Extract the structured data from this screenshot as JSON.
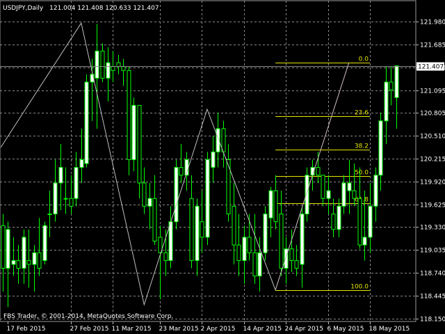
{
  "header": {
    "symbol": "USDJPY,Daily",
    "ohlc": "121.004 121.408 120.633 121.407"
  },
  "copyright": "FBS Trader, © 2001-2014, MetaQuotes Software Corp.",
  "current_price": "121.407",
  "colors": {
    "background": "#000000",
    "grid": "#8a8a8a",
    "candle": "#00ff00",
    "bull_body": "#ffffff",
    "bear_body": "#000000",
    "zigzag": "#c0c0c0",
    "fib_levels": "#e6e600",
    "fib_trend": "#ff0000",
    "axis_text": "#ffffff",
    "price_line": "#8c8c8c"
  },
  "chart_data": {
    "type": "candlestick",
    "ylim": [
      118.15,
      122.05
    ],
    "y_ticks": [
      "121.980",
      "121.685",
      "121.390",
      "121.095",
      "120.805",
      "120.510",
      "120.215",
      "119.920",
      "119.625",
      "119.330",
      "119.035",
      "118.740",
      "118.445",
      "118.150"
    ],
    "x_ticks": [
      "17 Feb 2015",
      "27 Feb 2015",
      "11 Mar 2015",
      "23 Mar 2015",
      "2 Apr 2015",
      "14 Apr 2015",
      "24 Apr 2015",
      "6 May 2015",
      "18 May 2015"
    ],
    "x_tick_index": [
      1,
      13,
      21,
      30,
      38,
      46,
      54,
      62,
      70
    ],
    "grid": true,
    "candles": [
      {
        "o": 119.35,
        "h": 119.5,
        "l": 118.5,
        "c": 118.8
      },
      {
        "o": 118.8,
        "h": 119.4,
        "l": 118.3,
        "c": 119.3
      },
      {
        "o": 118.85,
        "h": 119.2,
        "l": 118.7,
        "c": 118.9
      },
      {
        "o": 118.9,
        "h": 119.1,
        "l": 118.6,
        "c": 118.8
      },
      {
        "o": 118.8,
        "h": 119.3,
        "l": 118.6,
        "c": 119.2
      },
      {
        "o": 118.9,
        "h": 119.3,
        "l": 118.55,
        "c": 118.85
      },
      {
        "o": 118.85,
        "h": 119.1,
        "l": 118.5,
        "c": 119.0
      },
      {
        "o": 119.0,
        "h": 119.45,
        "l": 118.7,
        "c": 118.8
      },
      {
        "o": 118.9,
        "h": 119.4,
        "l": 118.85,
        "c": 119.35
      },
      {
        "o": 119.5,
        "h": 119.8,
        "l": 119.2,
        "c": 119.5
      },
      {
        "o": 119.5,
        "h": 120.2,
        "l": 119.4,
        "c": 119.9
      },
      {
        "o": 119.9,
        "h": 120.4,
        "l": 119.55,
        "c": 120.1
      },
      {
        "o": 119.7,
        "h": 120.1,
        "l": 119.5,
        "c": 119.7
      },
      {
        "o": 119.7,
        "h": 120.0,
        "l": 119.5,
        "c": 119.6
      },
      {
        "o": 119.7,
        "h": 120.3,
        "l": 119.6,
        "c": 120.1
      },
      {
        "o": 120.1,
        "h": 120.6,
        "l": 119.9,
        "c": 120.2
      },
      {
        "o": 120.15,
        "h": 121.3,
        "l": 120.1,
        "c": 121.2
      },
      {
        "o": 121.2,
        "h": 121.5,
        "l": 120.7,
        "c": 121.3
      },
      {
        "o": 121.25,
        "h": 121.95,
        "l": 120.6,
        "c": 121.6
      },
      {
        "o": 121.6,
        "h": 121.7,
        "l": 121.2,
        "c": 121.25
      },
      {
        "o": 121.25,
        "h": 121.65,
        "l": 120.95,
        "c": 121.45
      },
      {
        "o": 121.4,
        "h": 121.6,
        "l": 121.2,
        "c": 121.35
      },
      {
        "o": 121.45,
        "h": 121.55,
        "l": 121.3,
        "c": 121.4
      },
      {
        "o": 121.4,
        "h": 121.5,
        "l": 121.15,
        "c": 121.35
      },
      {
        "o": 121.35,
        "h": 121.4,
        "l": 120.0,
        "c": 120.2
      },
      {
        "o": 120.2,
        "h": 121.0,
        "l": 120.05,
        "c": 120.9
      },
      {
        "o": 120.9,
        "h": 120.9,
        "l": 119.7,
        "c": 119.9
      },
      {
        "o": 119.9,
        "h": 120.1,
        "l": 119.5,
        "c": 119.6
      },
      {
        "o": 119.6,
        "h": 119.9,
        "l": 119.3,
        "c": 119.7
      },
      {
        "o": 119.7,
        "h": 120.0,
        "l": 119.1,
        "c": 119.15
      },
      {
        "o": 119.2,
        "h": 119.35,
        "l": 118.4,
        "c": 119.0
      },
      {
        "o": 119.0,
        "h": 119.3,
        "l": 118.7,
        "c": 118.9
      },
      {
        "o": 118.9,
        "h": 119.6,
        "l": 118.8,
        "c": 119.4
      },
      {
        "o": 119.4,
        "h": 120.2,
        "l": 119.3,
        "c": 120.1
      },
      {
        "o": 120.1,
        "h": 120.4,
        "l": 119.9,
        "c": 120.0
      },
      {
        "o": 120.0,
        "h": 120.3,
        "l": 119.8,
        "c": 120.2
      },
      {
        "o": 119.7,
        "h": 120.0,
        "l": 118.8,
        "c": 118.9
      },
      {
        "o": 118.9,
        "h": 119.7,
        "l": 118.7,
        "c": 119.6
      },
      {
        "o": 119.4,
        "h": 119.8,
        "l": 119.0,
        "c": 119.2
      },
      {
        "o": 119.2,
        "h": 120.3,
        "l": 119.1,
        "c": 120.2
      },
      {
        "o": 120.1,
        "h": 120.5,
        "l": 119.9,
        "c": 120.3
      },
      {
        "o": 120.3,
        "h": 120.8,
        "l": 120.1,
        "c": 120.6
      },
      {
        "o": 120.6,
        "h": 120.7,
        "l": 120.1,
        "c": 120.3
      },
      {
        "o": 120.2,
        "h": 120.4,
        "l": 119.4,
        "c": 119.5
      },
      {
        "o": 119.6,
        "h": 119.9,
        "l": 118.85,
        "c": 119.1
      },
      {
        "o": 119.1,
        "h": 119.5,
        "l": 118.7,
        "c": 118.9
      },
      {
        "o": 118.9,
        "h": 119.35,
        "l": 118.6,
        "c": 119.2
      },
      {
        "o": 119.2,
        "h": 119.5,
        "l": 118.9,
        "c": 119.0
      },
      {
        "o": 119.0,
        "h": 119.5,
        "l": 118.6,
        "c": 118.7
      },
      {
        "o": 118.7,
        "h": 119.2,
        "l": 118.5,
        "c": 119.0
      },
      {
        "o": 119.0,
        "h": 119.6,
        "l": 118.9,
        "c": 119.5
      },
      {
        "o": 119.45,
        "h": 119.85,
        "l": 119.2,
        "c": 119.8
      },
      {
        "o": 119.8,
        "h": 120.0,
        "l": 119.3,
        "c": 119.4
      },
      {
        "o": 119.5,
        "h": 119.8,
        "l": 118.7,
        "c": 118.8
      },
      {
        "o": 118.8,
        "h": 119.2,
        "l": 118.6,
        "c": 119.05
      },
      {
        "o": 119.05,
        "h": 119.3,
        "l": 118.75,
        "c": 118.9
      },
      {
        "o": 118.9,
        "h": 119.1,
        "l": 118.7,
        "c": 118.8
      },
      {
        "o": 118.85,
        "h": 119.6,
        "l": 118.55,
        "c": 119.5
      },
      {
        "o": 119.5,
        "h": 120.1,
        "l": 119.4,
        "c": 120.0
      },
      {
        "o": 120.0,
        "h": 120.2,
        "l": 119.8,
        "c": 120.1
      },
      {
        "o": 120.1,
        "h": 120.3,
        "l": 119.9,
        "c": 120.0
      },
      {
        "o": 120.0,
        "h": 120.0,
        "l": 119.6,
        "c": 119.7
      },
      {
        "o": 119.7,
        "h": 120.0,
        "l": 119.5,
        "c": 119.8
      },
      {
        "o": 119.5,
        "h": 119.7,
        "l": 119.2,
        "c": 119.3
      },
      {
        "o": 119.3,
        "h": 119.7,
        "l": 119.2,
        "c": 119.6
      },
      {
        "o": 119.6,
        "h": 120.0,
        "l": 119.5,
        "c": 119.9
      },
      {
        "o": 119.8,
        "h": 120.2,
        "l": 119.5,
        "c": 119.9
      },
      {
        "o": 119.8,
        "h": 120.15,
        "l": 119.6,
        "c": 119.7
      },
      {
        "o": 119.7,
        "h": 120.1,
        "l": 119.05,
        "c": 119.1
      },
      {
        "o": 119.1,
        "h": 119.8,
        "l": 118.9,
        "c": 119.2
      },
      {
        "o": 119.2,
        "h": 119.9,
        "l": 119.0,
        "c": 119.6
      },
      {
        "o": 119.6,
        "h": 120.1,
        "l": 119.4,
        "c": 120.0
      },
      {
        "o": 120.0,
        "h": 120.8,
        "l": 119.8,
        "c": 120.7
      },
      {
        "o": 120.7,
        "h": 121.4,
        "l": 120.4,
        "c": 121.2
      },
      {
        "o": 121.2,
        "h": 121.4,
        "l": 120.9,
        "c": 121.1
      },
      {
        "o": 121.0,
        "h": 121.4,
        "l": 120.6,
        "c": 121.41
      }
    ],
    "zigzag": [
      {
        "i": -0.3,
        "p": 120.36
      },
      {
        "i": 15,
        "p": 121.96
      },
      {
        "i": 27,
        "p": 118.33
      },
      {
        "i": 39,
        "p": 120.85
      },
      {
        "i": 52,
        "p": 118.52
      },
      {
        "i": 66,
        "p": 121.45
      }
    ],
    "fibonacci": {
      "start_index": 52,
      "end_index": 70,
      "trend": [
        {
          "i": 52,
          "p": 118.52
        },
        {
          "i": 66,
          "p": 121.45
        }
      ],
      "levels": [
        {
          "label": "0.0",
          "price": 121.45
        },
        {
          "label": "23.6",
          "price": 120.76
        },
        {
          "label": "38.2",
          "price": 120.33
        },
        {
          "label": "50.0",
          "price": 119.99
        },
        {
          "label": "61.8",
          "price": 119.64
        },
        {
          "label": "100.0",
          "price": 118.52
        }
      ]
    },
    "current_price": 121.407
  }
}
